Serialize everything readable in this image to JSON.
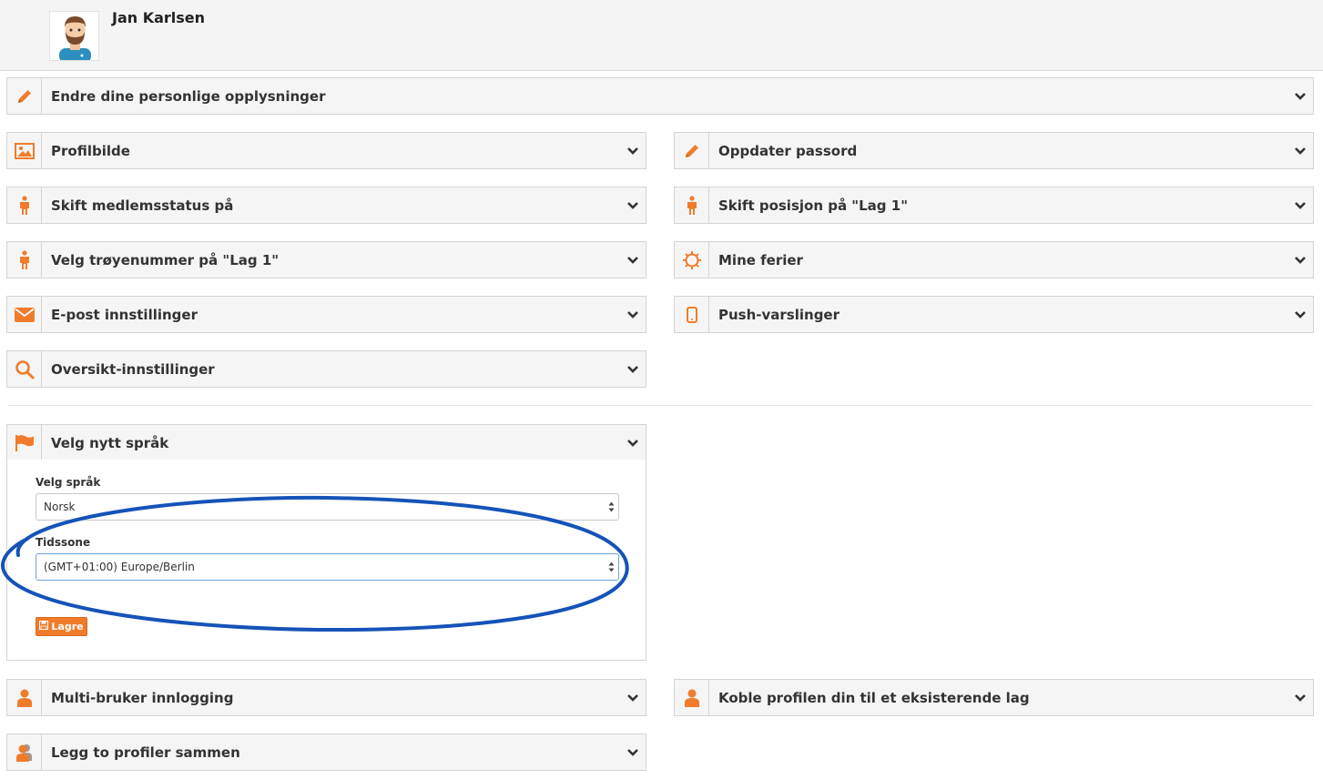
{
  "user": {
    "name": "Jan Karlsen"
  },
  "panels": {
    "personal_info": {
      "label": "Endre dine personlige opplysninger",
      "icon": "pencil-icon"
    },
    "profile_picture": {
      "label": "Profilbilde",
      "icon": "image-icon"
    },
    "update_password": {
      "label": "Oppdater passord",
      "icon": "pencil-icon"
    },
    "member_status": {
      "label": "Skift medlemsstatus på",
      "icon": "person-icon"
    },
    "position": {
      "label": "Skift posisjon på \"Lag 1\"",
      "icon": "person-icon"
    },
    "jersey_number": {
      "label": "Velg trøyenummer på \"Lag 1\"",
      "icon": "person-icon"
    },
    "holidays": {
      "label": "Mine ferier",
      "icon": "sun-icon"
    },
    "email_settings": {
      "label": "E-post innstillinger",
      "icon": "envelope-icon"
    },
    "push": {
      "label": "Push-varslinger",
      "icon": "mobile-icon"
    },
    "overview_settings": {
      "label": "Oversikt-innstillinger",
      "icon": "search-icon"
    },
    "language": {
      "label": "Velg nytt språk",
      "icon": "flag-icon"
    },
    "multi_user": {
      "label": "Multi-bruker innlogging",
      "icon": "user-icon"
    },
    "link_profile": {
      "label": "Koble profilen din til et eksisterende lag",
      "icon": "user-icon"
    },
    "merge_profiles": {
      "label": "Legg to profiler sammen",
      "icon": "users-icon"
    }
  },
  "language_form": {
    "language_label": "Velg språk",
    "language_value": "Norsk",
    "timezone_label": "Tidssone",
    "timezone_value": "(GMT+01:00) Europe/Berlin",
    "save_label": "Lagre"
  },
  "colors": {
    "accent": "#f07c2b",
    "annotation": "#1553b8"
  }
}
